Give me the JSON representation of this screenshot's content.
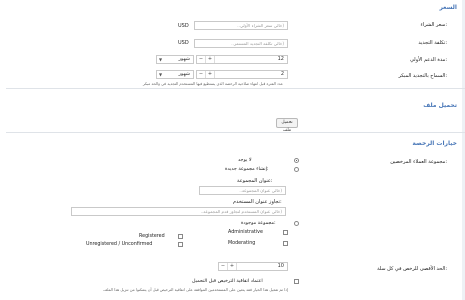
{
  "sections": {
    "pricing": {
      "title": "السعر",
      "purchase_cost": {
        "label": "سعر الشراء:",
        "placeholder": "(خالي سعر الشراء الأولي..",
        "unit": "USD"
      },
      "renewal_cost": {
        "label": "تكلفة التجديد:",
        "placeholder": "(خالي تكلفة التجديد المستمر..",
        "unit": "USD"
      },
      "initial_duration": {
        "label": "مدة الدعم الأولي:",
        "value": "12",
        "unit": "شهور"
      },
      "early_renewal": {
        "label": "السماح بالتجديد المبكر:",
        "value": "2",
        "unit": "شهور",
        "hint": "عدد الفترة قبل انتهاء صلاحية الرخصة الذي يستطيع فيها المستخدم التجديد في والحد مبكر"
      }
    },
    "file": {
      "title": "تحميل ملف",
      "upload_label": "تحميل ملف"
    },
    "purchase_options": {
      "title": "خيارات الرخصة",
      "user_group": {
        "label": "مجموعة العملاء المرخصين:"
      },
      "opt_none": "لا يوجد",
      "opt_new_group": "إنشاء مجموعة جديدة:",
      "group_title": {
        "label": "عنوان المجموعة:",
        "placeholder": "(خالي عنوان المجموعة.."
      },
      "override_title": {
        "label": "تجاوز عنوان المستخدم:",
        "placeholder": "(خالي عنوان المستخدم لتجاوز قدم المجموعة.."
      },
      "opt_existing": "مجموعة موجودة:",
      "groups": [
        "Administrative",
        "Registered",
        "Moderating",
        "Unregistered / Unconfirmed"
      ],
      "max_per_user": {
        "label": "الحد الأقصى للرخص في كل سلة:",
        "value": "10"
      },
      "accept_terms": {
        "label": "اعتماد اتفاقية الترخيص قبل التحميل",
        "hint": "إذا تم تفعيل هذا الخيار فقد يتعين على المستخدمين الموافقة على اتفاقية الترخيص قبل أن يتمكنوا من تنزيل هذا الملف"
      }
    }
  },
  "colors": {
    "accent": "#4a78b8",
    "border": "#c9c9c9"
  }
}
